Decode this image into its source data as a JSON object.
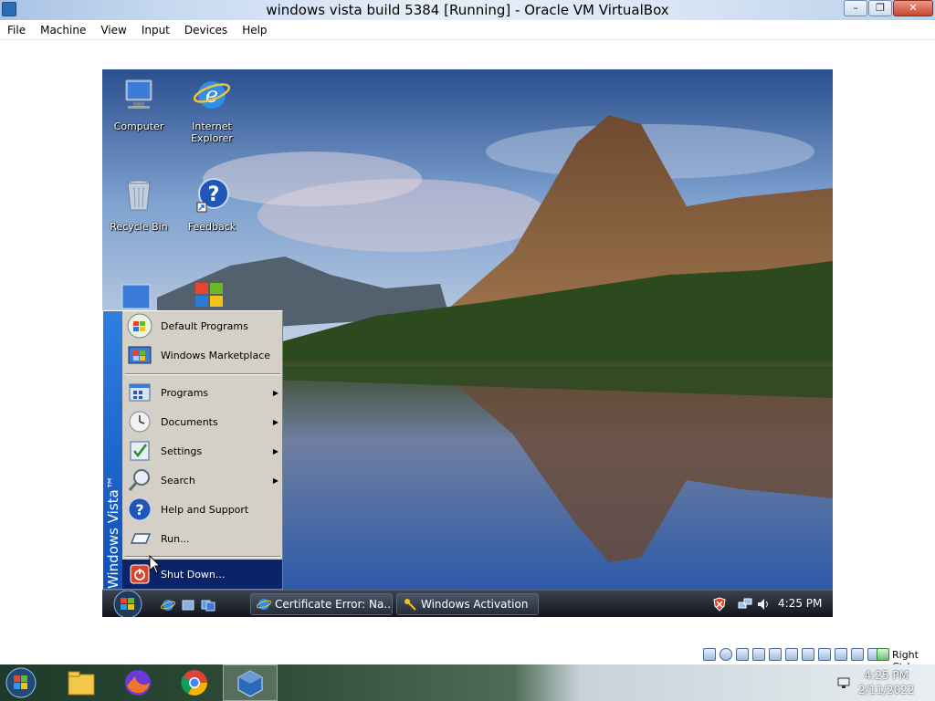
{
  "host_window": {
    "title": "windows vista build 5384 [Running] - Oracle VM VirtualBox",
    "minimize": "–",
    "restore": "❐",
    "close": "✕"
  },
  "host_menu": [
    "File",
    "Machine",
    "View",
    "Input",
    "Devices",
    "Help"
  ],
  "desktop_icons": [
    {
      "label": "Computer"
    },
    {
      "label": "Internet Explorer"
    },
    {
      "label": "Recycle Bin"
    },
    {
      "label": "Feedback"
    }
  ],
  "start_menu": {
    "side_text": "Windows Vista™",
    "items": [
      {
        "label": "Default Programs",
        "submenu": false
      },
      {
        "label": "Windows Marketplace",
        "submenu": false
      },
      {
        "label": "Programs",
        "submenu": true
      },
      {
        "label": "Documents",
        "submenu": true
      },
      {
        "label": "Settings",
        "submenu": true
      },
      {
        "label": "Search",
        "submenu": true
      },
      {
        "label": "Help and Support",
        "submenu": false
      },
      {
        "label": "Run...",
        "submenu": false
      },
      {
        "label": "Shut Down...",
        "submenu": false,
        "highlighted": true
      }
    ],
    "arrow_glyph": "▶"
  },
  "guest_taskbar": {
    "buttons": [
      {
        "label": "Certificate Error: Na..."
      },
      {
        "label": "Windows Activation"
      }
    ],
    "clock": "4:25 PM"
  },
  "host_status": {
    "host_key": "Right Ctrl"
  },
  "host_taskbar": {
    "clock_time": "4:25 PM",
    "clock_date": "2/11/2022"
  },
  "colors": {
    "start_side": "#1560cc",
    "highlight": "#0a246a",
    "menu_bg": "#d4d0c8"
  }
}
